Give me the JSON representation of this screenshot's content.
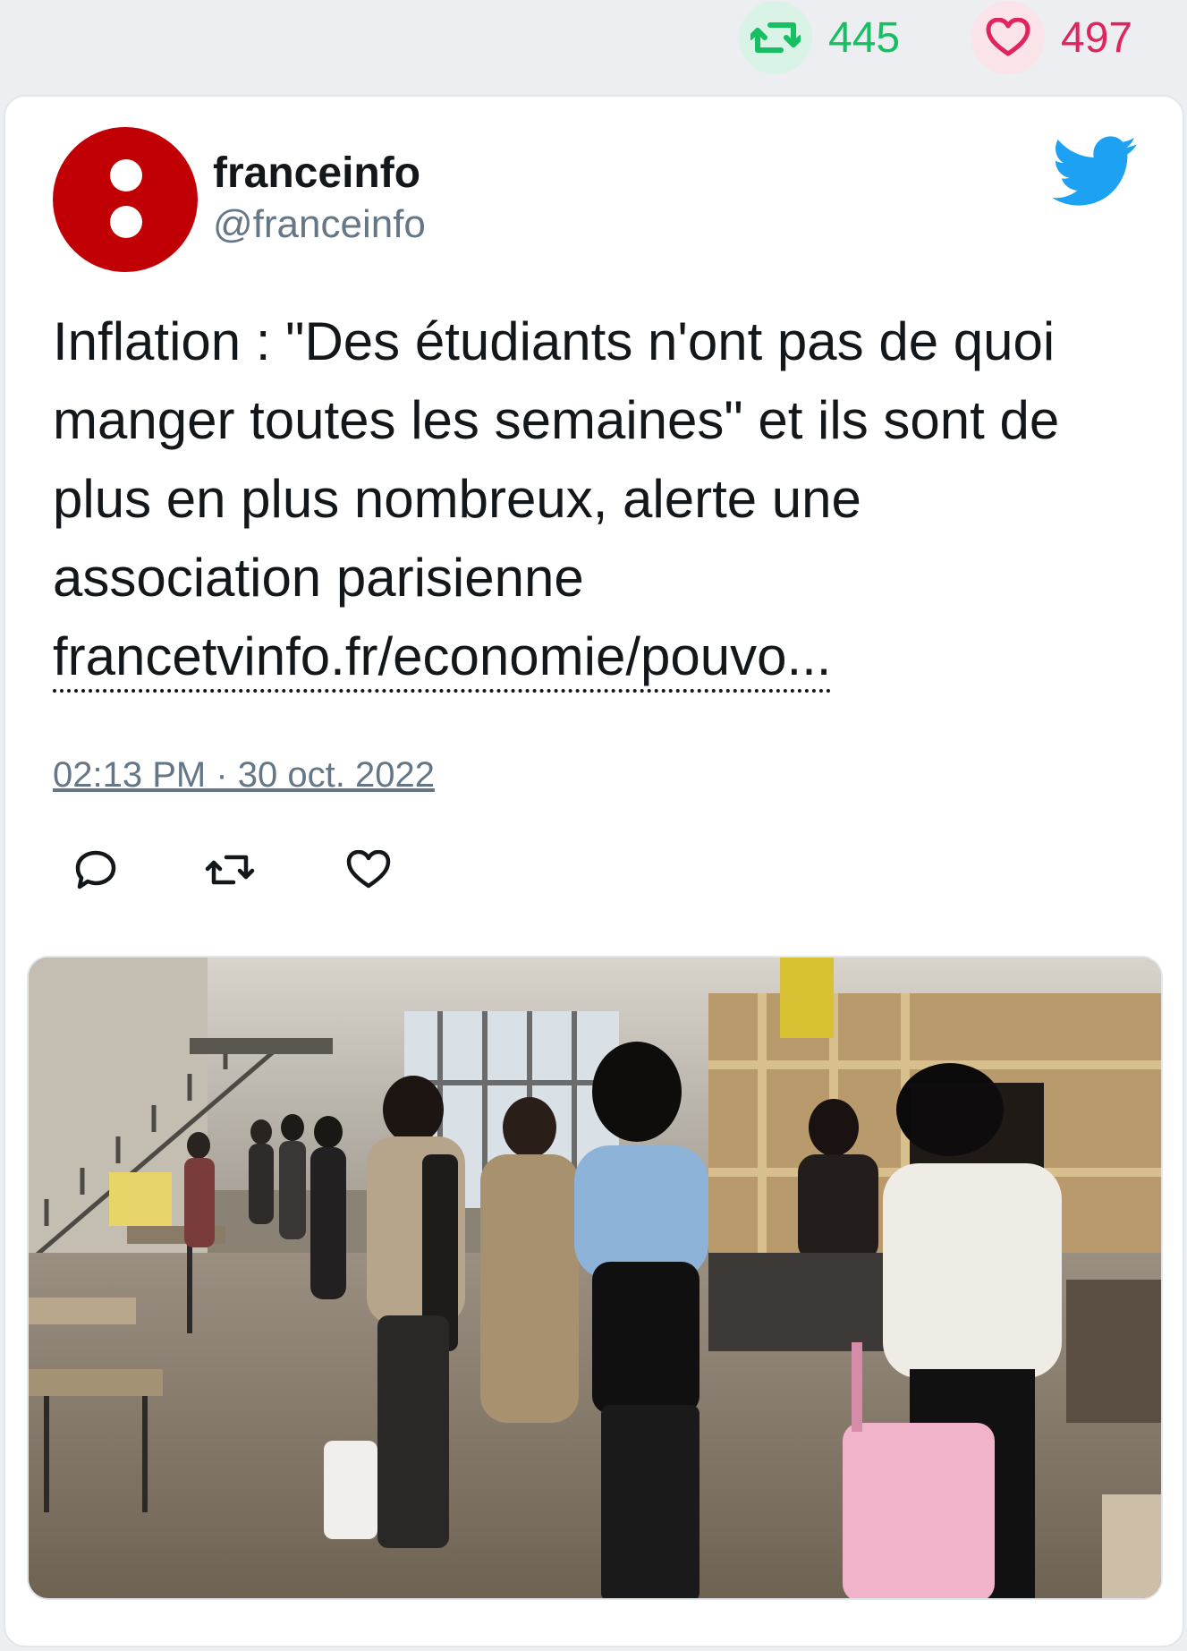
{
  "stats": {
    "retweets": "445",
    "likes": "497"
  },
  "author": {
    "name": "franceinfo",
    "handle": "@franceinfo"
  },
  "tweet": {
    "text": "Inflation : \"Des étudiants n'ont pas de quoi manger toutes les semaines\" et ils sont de plus en plus nombreux, alerte une association parisienne",
    "link": "francetvinfo.fr/economie/pouvo...",
    "timestamp": "02:13 PM · 30 oct. 2022"
  },
  "colors": {
    "retweet": "#17bf63",
    "like": "#e0245e",
    "twitter_blue": "#1da1f2",
    "avatar": "#c00005"
  },
  "icons": {
    "retweet": "retweet-icon",
    "like": "heart-icon",
    "reply": "reply-icon",
    "brand": "twitter-bird-icon"
  }
}
